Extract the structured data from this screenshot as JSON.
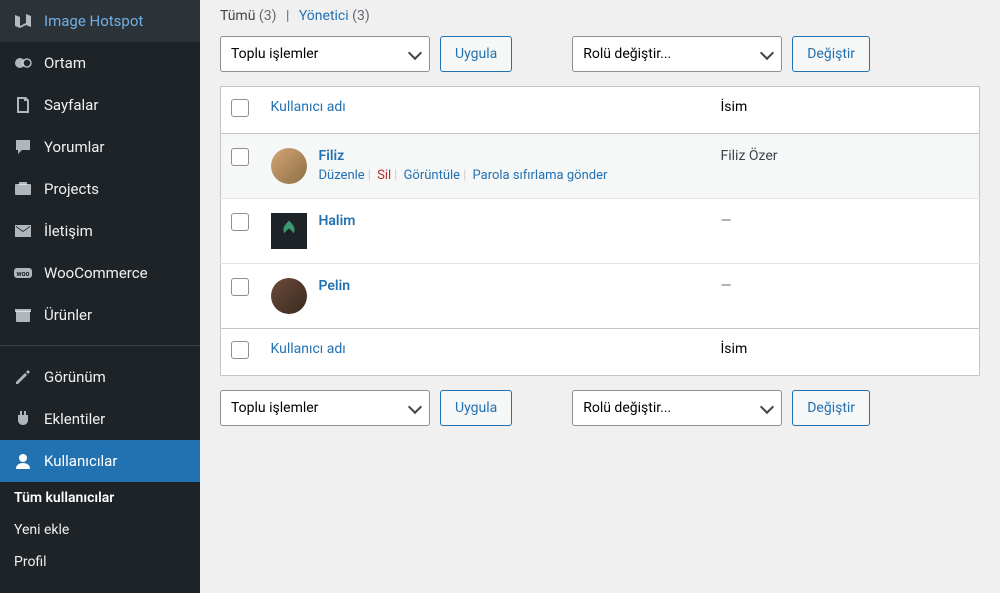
{
  "sidebar": {
    "items": [
      {
        "label": "Image Hotspot",
        "icon": "map"
      },
      {
        "label": "Ortam",
        "icon": "media"
      },
      {
        "label": "Sayfalar",
        "icon": "pages"
      },
      {
        "label": "Yorumlar",
        "icon": "comments"
      },
      {
        "label": "Projects",
        "icon": "projects"
      },
      {
        "label": "İletişim",
        "icon": "mail"
      },
      {
        "label": "WooCommerce",
        "icon": "woo"
      },
      {
        "label": "Ürünler",
        "icon": "products"
      }
    ],
    "items2": [
      {
        "label": "Görünüm",
        "icon": "appearance"
      },
      {
        "label": "Eklentiler",
        "icon": "plugins"
      },
      {
        "label": "Kullanıcılar",
        "icon": "users",
        "active": true
      }
    ],
    "submenu": [
      {
        "label": "Tüm kullanıcılar",
        "current": true
      },
      {
        "label": "Yeni ekle"
      },
      {
        "label": "Profil"
      }
    ]
  },
  "filters": {
    "all_label": "Tümü",
    "all_count": "(3)",
    "sep": "|",
    "admin_label": "Yönetici",
    "admin_count": "(3)"
  },
  "controls": {
    "bulk_placeholder": "Toplu işlemler",
    "apply_label": "Uygula",
    "role_placeholder": "Rolü değiştir...",
    "change_label": "Değiştir"
  },
  "table": {
    "header_user": "Kullanıcı adı",
    "header_name": "İsim",
    "rows": [
      {
        "username": "Filiz",
        "name": "Filiz Özer",
        "avatar": "f1",
        "actions": {
          "edit": "Düzenle",
          "delete": "Sil",
          "view": "Görüntüle",
          "reset": "Parola sıfırlama gönder"
        }
      },
      {
        "username": "Halim",
        "name": "—",
        "avatar": "leaf"
      },
      {
        "username": "Pelin",
        "name": "—",
        "avatar": "f2"
      }
    ]
  }
}
